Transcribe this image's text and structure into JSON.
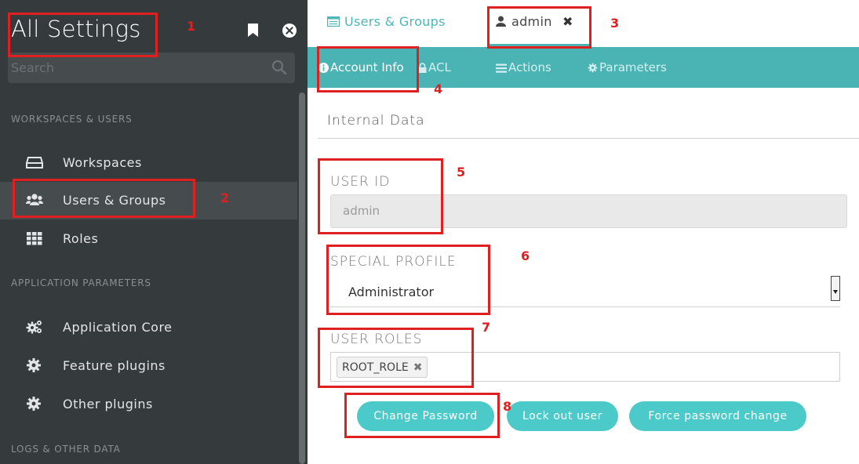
{
  "sidebar": {
    "title": "All Settings",
    "search_placeholder": "Search",
    "sections": [
      {
        "label": "WORKSPACES & USERS"
      },
      {
        "label": "APPLICATION PARAMETERS"
      },
      {
        "label": "LOGS & OTHER DATA"
      }
    ],
    "items": [
      {
        "label": "Workspaces",
        "icon": "drive-icon"
      },
      {
        "label": "Users & Groups",
        "icon": "users-icon",
        "active": true
      },
      {
        "label": "Roles",
        "icon": "grid-icon"
      },
      {
        "label": "Application Core",
        "icon": "cogs-icon"
      },
      {
        "label": "Feature plugins",
        "icon": "gear-icon"
      },
      {
        "label": "Other plugins",
        "icon": "gear-icon"
      }
    ]
  },
  "tabs": [
    {
      "label": "Users & Groups",
      "icon": "list-icon"
    },
    {
      "label": "admin",
      "icon": "user-icon",
      "active": true,
      "closable": true
    }
  ],
  "subnav": [
    {
      "label": "Account Info",
      "icon": "info-icon",
      "active": true
    },
    {
      "label": "ACL",
      "icon": "lock-icon"
    },
    {
      "label": "Actions",
      "icon": "bars-icon"
    },
    {
      "label": "Parameters",
      "icon": "gear-icon"
    }
  ],
  "form": {
    "section_title": "Internal Data",
    "user_id_label": "USER ID",
    "user_id_value": "admin",
    "special_profile_label": "SPECIAL PROFILE",
    "special_profile_value": "Administrator",
    "user_roles_label": "USER ROLES",
    "roles": [
      "ROOT_ROLE"
    ]
  },
  "buttons": {
    "change_password": "Change Password",
    "lock_out": "Lock out user",
    "force_change": "Force password change"
  },
  "annotations": [
    "1",
    "2",
    "3",
    "4",
    "5",
    "6",
    "7",
    "8"
  ],
  "colors": {
    "sidebar_bg": "#353b3d",
    "accent": "#4ab3b4",
    "button": "#4ccaca",
    "annotation": "#e02020"
  }
}
